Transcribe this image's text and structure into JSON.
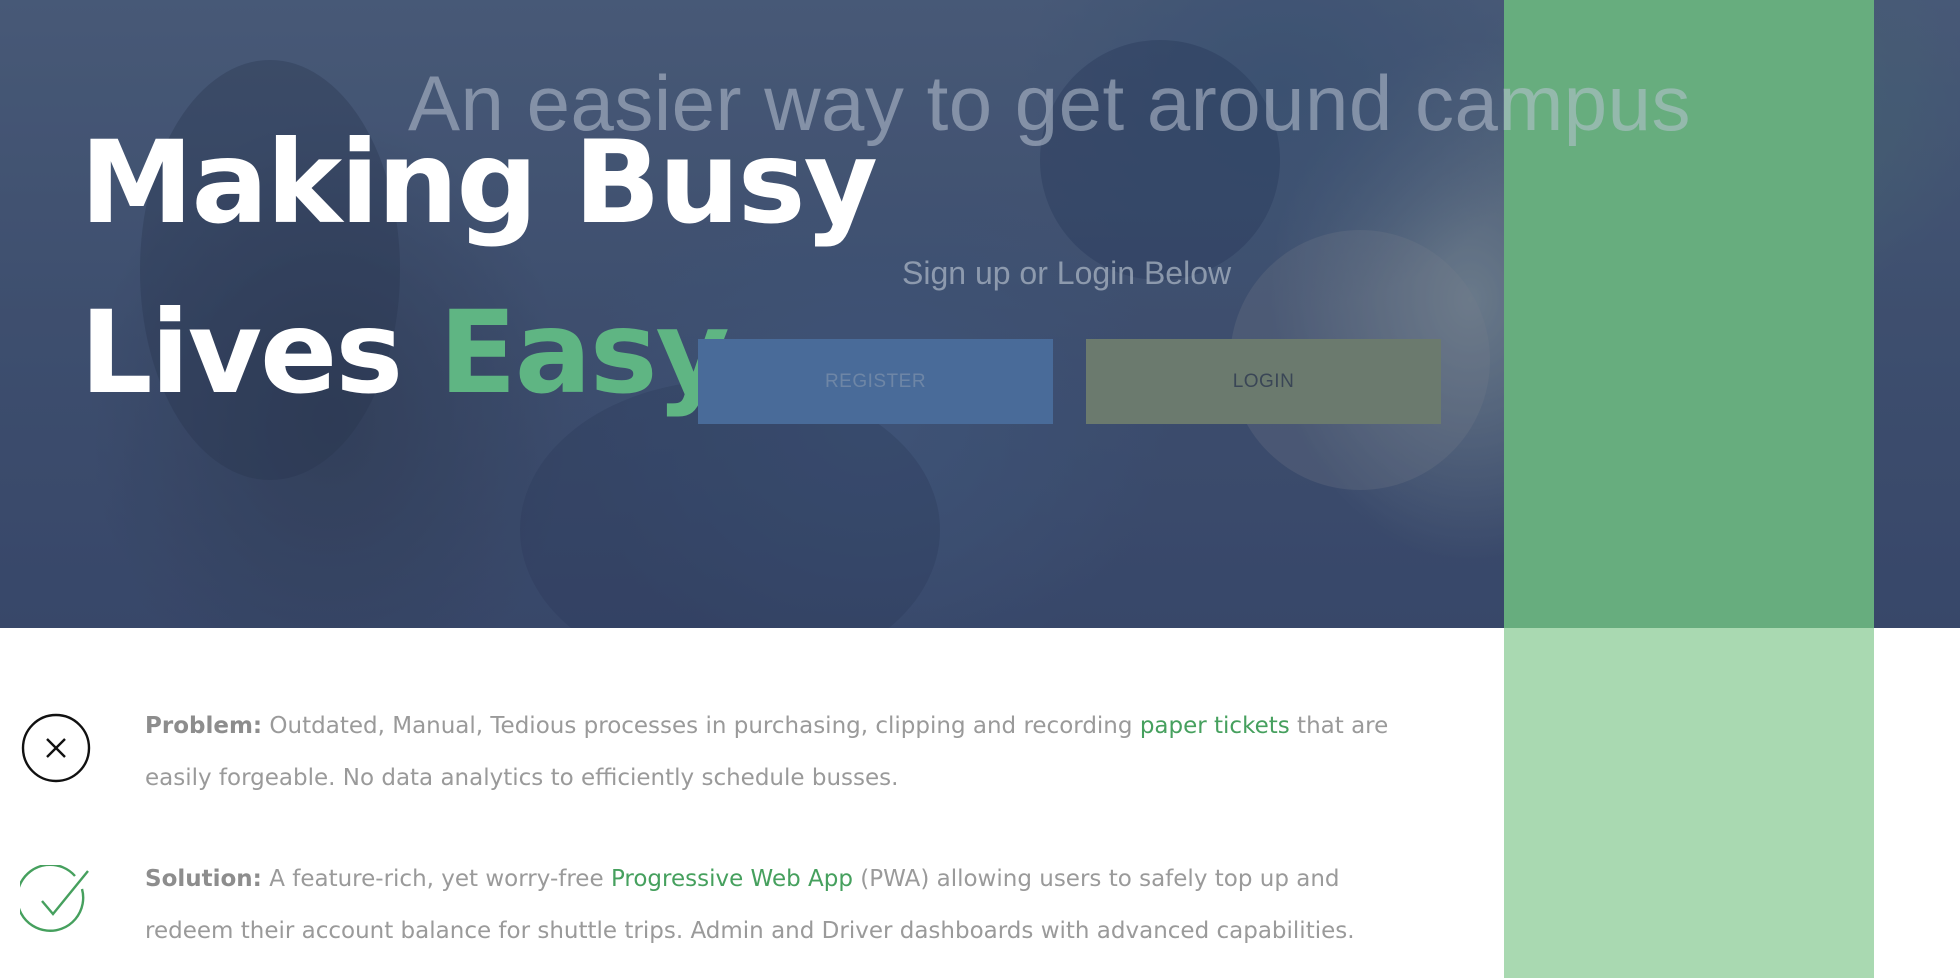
{
  "hero": {
    "tagline": "An easier way to get around campus",
    "headline_line1": "Making Busy",
    "headline_line2_prefix": "Lives ",
    "headline_line2_accent": "Easy",
    "headline_line2_suffix": ".",
    "subheading": "Sign up or Login Below",
    "register_label": "REGISTER",
    "login_label": "LOGIN"
  },
  "problem": {
    "icon": "close-icon",
    "lead": "Problem:",
    "text_before": " Outdated, Manual, Tedious processes in purchasing, clipping and recording ",
    "highlight": "paper tickets",
    "text_after": " that are easily forgeable. No data analytics to efficiently schedule busses."
  },
  "solution": {
    "icon": "checkmark-icon",
    "lead": "Solution:",
    "text_before": " A feature-rich, yet worry-free ",
    "highlight": "Progressive Web App",
    "text_after": " (PWA) allowing users to safely top up and redeem their account balance for shuttle trips. Admin and Driver dashboards with advanced capabilities."
  },
  "colors": {
    "accent_green": "#5fb583",
    "link_green": "#46a05e",
    "hero_overlay": "#3f5070",
    "side_column": "#a9d9b1",
    "register_button": "#496b99",
    "login_button": "#6b7a6e"
  }
}
